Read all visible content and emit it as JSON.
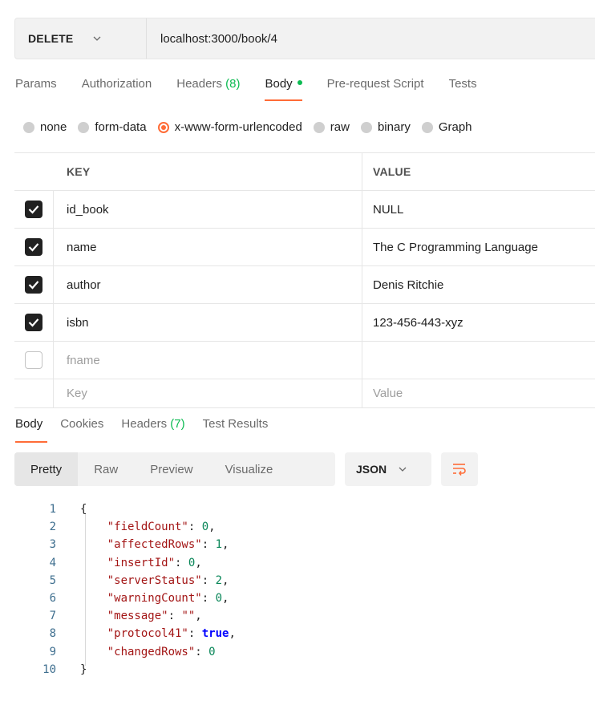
{
  "request": {
    "method": "DELETE",
    "url": "localhost:3000/book/4"
  },
  "request_tabs": [
    {
      "label": "Params",
      "count": ""
    },
    {
      "label": "Authorization",
      "count": ""
    },
    {
      "label": "Headers",
      "count": "(8)"
    },
    {
      "label": "Body",
      "count": "",
      "active": true
    },
    {
      "label": "Pre-request Script",
      "count": ""
    },
    {
      "label": "Tests",
      "count": ""
    }
  ],
  "body_types": [
    {
      "label": "none",
      "selected": false
    },
    {
      "label": "form-data",
      "selected": false
    },
    {
      "label": "x-www-form-urlencoded",
      "selected": true
    },
    {
      "label": "raw",
      "selected": false
    },
    {
      "label": "binary",
      "selected": false
    },
    {
      "label": "Graph",
      "selected": false
    }
  ],
  "kv_table": {
    "key_header": "KEY",
    "value_header": "VALUE",
    "rows": [
      {
        "checked": true,
        "key": "id_book",
        "value": "NULL"
      },
      {
        "checked": true,
        "key": "name",
        "value": "The C Programming Language"
      },
      {
        "checked": true,
        "key": "author",
        "value": "Denis Ritchie"
      },
      {
        "checked": true,
        "key": "isbn",
        "value": "123-456-443-xyz"
      },
      {
        "checked": false,
        "key": "fname",
        "value": ""
      }
    ],
    "key_placeholder": "Key",
    "value_placeholder": "Value"
  },
  "response_tabs": [
    {
      "label": "Body",
      "count": "",
      "active": true
    },
    {
      "label": "Cookies",
      "count": ""
    },
    {
      "label": "Headers",
      "count": "(7)"
    },
    {
      "label": "Test Results",
      "count": ""
    }
  ],
  "view_modes": [
    "Pretty",
    "Raw",
    "Preview",
    "Visualize"
  ],
  "format": "JSON",
  "response_body": [
    {
      "n": "1",
      "parts": [
        [
          "punc",
          "{"
        ]
      ]
    },
    {
      "n": "2",
      "parts": [
        [
          "key",
          "    \"fieldCount\""
        ],
        [
          "punc",
          ": "
        ],
        [
          "num",
          "0"
        ],
        [
          "punc",
          ","
        ]
      ]
    },
    {
      "n": "3",
      "parts": [
        [
          "key",
          "    \"affectedRows\""
        ],
        [
          "punc",
          ": "
        ],
        [
          "num",
          "1"
        ],
        [
          "punc",
          ","
        ]
      ]
    },
    {
      "n": "4",
      "parts": [
        [
          "key",
          "    \"insertId\""
        ],
        [
          "punc",
          ": "
        ],
        [
          "num",
          "0"
        ],
        [
          "punc",
          ","
        ]
      ]
    },
    {
      "n": "5",
      "parts": [
        [
          "key",
          "    \"serverStatus\""
        ],
        [
          "punc",
          ": "
        ],
        [
          "num",
          "2"
        ],
        [
          "punc",
          ","
        ]
      ]
    },
    {
      "n": "6",
      "parts": [
        [
          "key",
          "    \"warningCount\""
        ],
        [
          "punc",
          ": "
        ],
        [
          "num",
          "0"
        ],
        [
          "punc",
          ","
        ]
      ]
    },
    {
      "n": "7",
      "parts": [
        [
          "key",
          "    \"message\""
        ],
        [
          "punc",
          ": "
        ],
        [
          "str",
          "\"\""
        ],
        [
          "punc",
          ","
        ]
      ]
    },
    {
      "n": "8",
      "parts": [
        [
          "key",
          "    \"protocol41\""
        ],
        [
          "punc",
          ": "
        ],
        [
          "bool",
          "true"
        ],
        [
          "punc",
          ","
        ]
      ]
    },
    {
      "n": "9",
      "parts": [
        [
          "key",
          "    \"changedRows\""
        ],
        [
          "punc",
          ": "
        ],
        [
          "num",
          "0"
        ]
      ]
    },
    {
      "n": "10",
      "parts": [
        [
          "punc",
          "}"
        ]
      ]
    }
  ],
  "colors": {
    "accent": "#ff6c37",
    "success": "#0cbb52"
  }
}
